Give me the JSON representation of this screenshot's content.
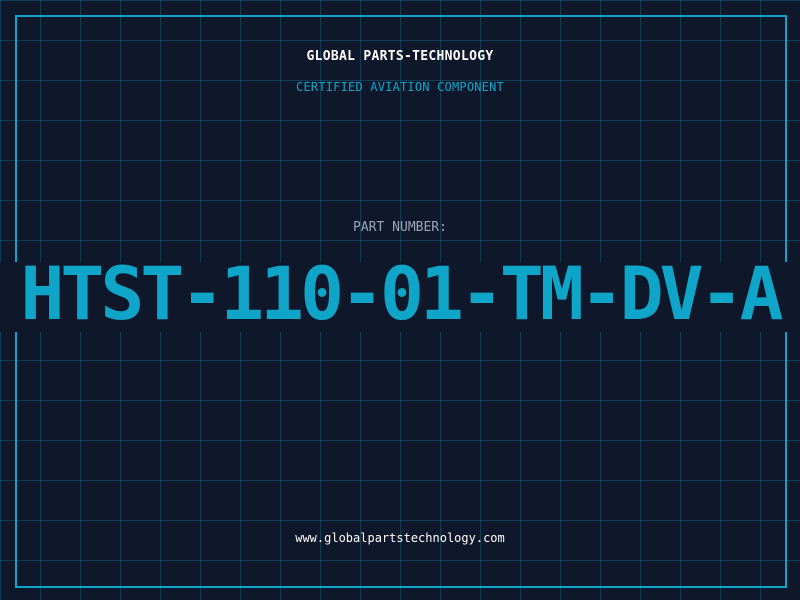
{
  "header": {
    "company": "GLOBAL PARTS-TECHNOLOGY",
    "subtitle": "CERTIFIED AVIATION COMPONENT"
  },
  "part": {
    "label": "PART NUMBER:",
    "number": "HTST-110-01-TM-DV-A"
  },
  "footer": {
    "website": "www.globalpartstechnology.com"
  },
  "colors": {
    "background": "#0f172a",
    "accent": "#0ea5c9",
    "grid": "#0e6a85",
    "text": "#ffffff",
    "muted": "#9aa7ba"
  }
}
